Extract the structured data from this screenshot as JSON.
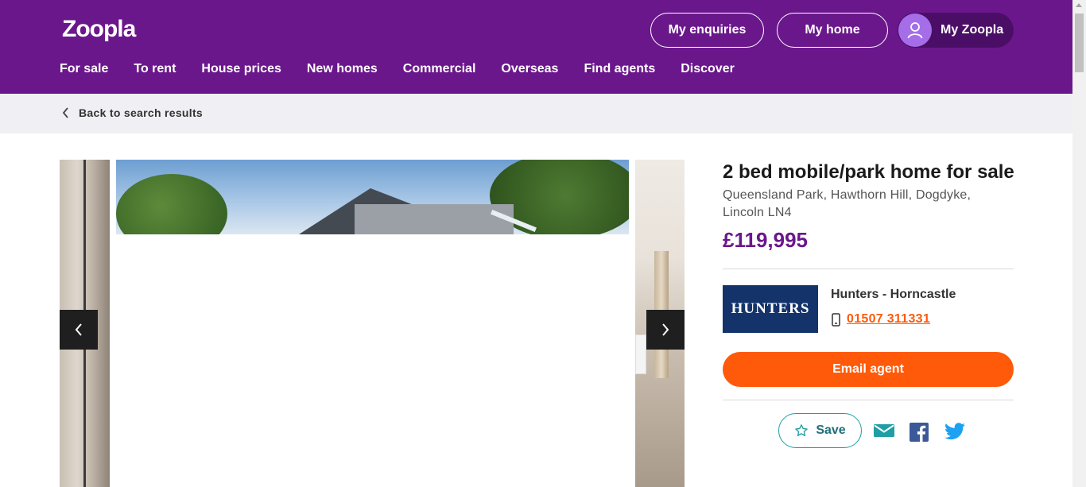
{
  "header": {
    "logo": "Zoopla",
    "buttons": {
      "enquiries": "My enquiries",
      "home": "My home",
      "my_zoopla": "My Zoopla"
    },
    "nav": [
      "For sale",
      "To rent",
      "House prices",
      "New homes",
      "Commercial",
      "Overseas",
      "Find agents",
      "Discover"
    ]
  },
  "subbar": {
    "back_label": "Back to search results"
  },
  "listing": {
    "title": "2 bed mobile/park home for sale",
    "address": "Queensland Park, Hawthorn Hill, Dogdyke, Lincoln LN4",
    "price": "£119,995"
  },
  "agent": {
    "logo_text": "HUNTERS",
    "name": "Hunters - Horncastle",
    "phone": "01507 311331"
  },
  "actions": {
    "email_agent": "Email agent",
    "save": "Save"
  },
  "icons": {
    "avatar": "user-icon",
    "back": "chevron-left-icon",
    "gallery_prev": "chevron-left-icon",
    "gallery_next": "chevron-right-icon",
    "phone": "mobile-phone-icon",
    "save": "star-icon",
    "share_email": "envelope-icon",
    "share_facebook": "facebook-icon",
    "share_twitter": "twitter-icon"
  },
  "colors": {
    "brand_purple": "#6b178c",
    "accent_orange": "#ff5a09",
    "teal": "#1e9fa5",
    "agent_navy": "#14336b",
    "facebook": "#3b5998",
    "twitter": "#1da1f2"
  }
}
